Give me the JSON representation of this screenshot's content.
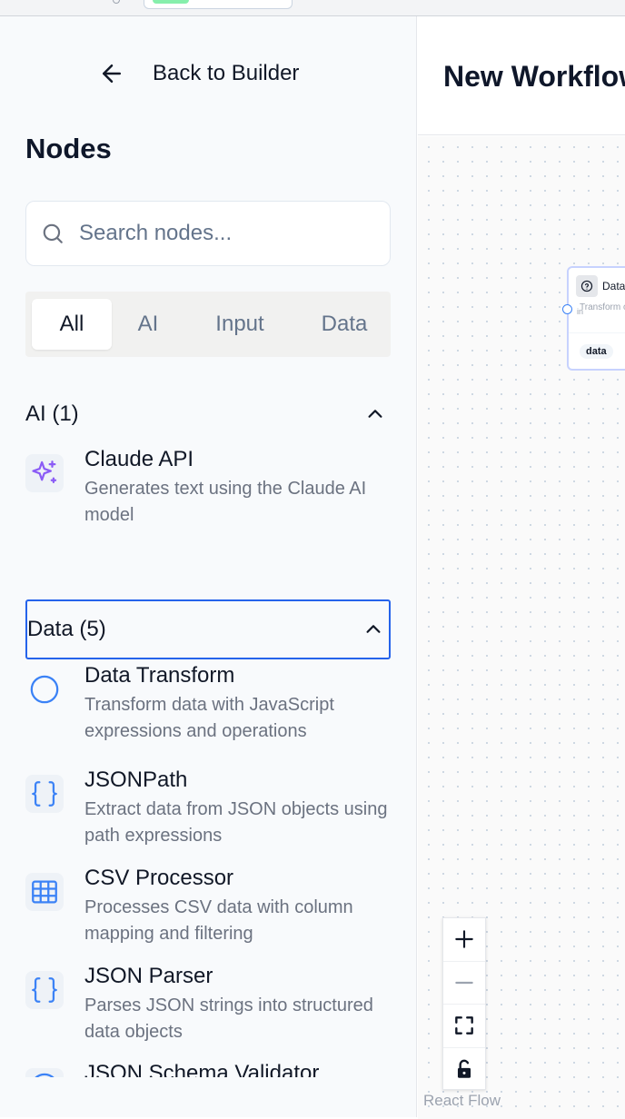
{
  "sidebar": {
    "back_label": "Back to Builder",
    "title": "Nodes",
    "search": {
      "placeholder": "Search nodes...",
      "value": ""
    },
    "tabs": [
      {
        "label": "All",
        "active": true
      },
      {
        "label": "AI",
        "active": false
      },
      {
        "label": "Input",
        "active": false
      },
      {
        "label": "Data",
        "active": false
      }
    ],
    "groups": [
      {
        "label": "AI (1)",
        "expanded": true,
        "items": [
          {
            "name": "Claude API",
            "description": "Generates text using the Claude AI model",
            "icon": "sparkles-icon"
          }
        ]
      },
      {
        "label": "Data (5)",
        "expanded": true,
        "focused": true,
        "items": [
          {
            "name": "Data Transform",
            "description": "Transform data with JavaScript expressions and operations",
            "icon": "circle-icon"
          },
          {
            "name": "JSONPath",
            "description": "Extract data from JSON objects using path expressions",
            "icon": "braces-icon"
          },
          {
            "name": "CSV Processor",
            "description": "Processes CSV data with column mapping and filtering",
            "icon": "table-icon"
          },
          {
            "name": "JSON Parser",
            "description": "Parses JSON strings into structured data objects",
            "icon": "braces-icon"
          },
          {
            "name": "JSON Schema Validator",
            "description": "",
            "icon": "circle-icon"
          }
        ]
      }
    ]
  },
  "workflow": {
    "title": "New Workflow",
    "node": {
      "title": "Data",
      "description": "Transform operations",
      "input_label": "in",
      "tag": "data",
      "icon": "question-circle-icon"
    }
  },
  "canvas_controls": [
    "zoom-in-icon",
    "zoom-out-icon",
    "fit-view-icon",
    "lock-icon"
  ],
  "attribution": "React Flow",
  "colors": {
    "accent": "#2563eb",
    "ai_icon": "#8b5cf6",
    "data_icon": "#3b82f6"
  }
}
